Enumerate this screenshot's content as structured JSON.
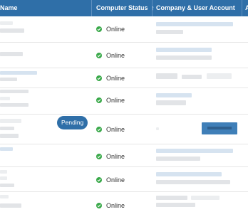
{
  "columns": {
    "name": "Name",
    "computer_status": "Computer Status",
    "sort_arrow": "↑",
    "company_user": "Company & User Account",
    "next_col_fragment": "A"
  },
  "colors": {
    "header_bg": "#2f6fa8",
    "online_green": "#3aa94a",
    "pending_blue": "#2f6fa8"
  },
  "rows": [
    {
      "status": "Online"
    },
    {
      "status": "Online"
    },
    {
      "status": "Online"
    },
    {
      "status": "Online"
    },
    {
      "status": "Online",
      "badge": "Pending"
    },
    {
      "status": "Online"
    },
    {
      "status": "Online"
    },
    {
      "status": "Online"
    }
  ]
}
